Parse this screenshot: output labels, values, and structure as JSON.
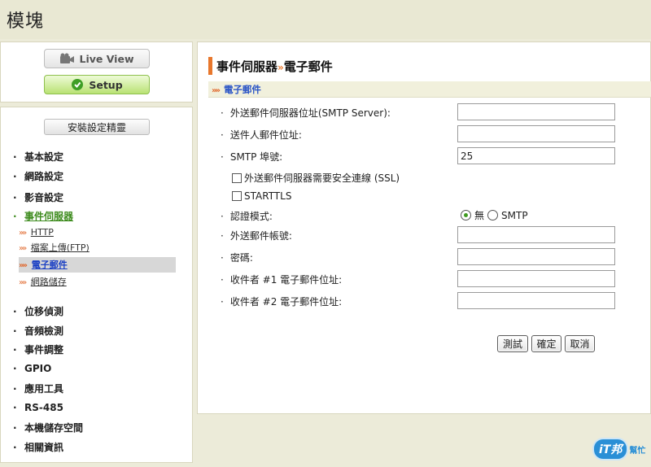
{
  "header": {
    "title": "模塊"
  },
  "modes": {
    "liveview": "Live View",
    "setup": "Setup"
  },
  "wizard": "安裝設定精靈",
  "menu": {
    "basic": "基本設定",
    "network": "網路設定",
    "av": "影音設定",
    "event_server": "事件伺服器",
    "sub": {
      "http": "HTTP",
      "ftp": "檔案上傳(FTP)",
      "email": "電子郵件",
      "netstorage": "網路儲存"
    },
    "motion": "位移偵測",
    "audio_detect": "音頻檢測",
    "event_adjust": "事件調整",
    "gpio": "GPIO",
    "tools": "應用工具",
    "rs485": "RS-485",
    "local_storage": "本機儲存空間",
    "info": "相關資訊"
  },
  "page": {
    "title_main": "事件伺服器",
    "title_sep": "»",
    "title_sub": "電子郵件",
    "section": "電子郵件",
    "section_arrow": "»»"
  },
  "form": {
    "smtp_server_label": "外送郵件伺服器位址(SMTP Server):",
    "smtp_server_value": "",
    "sender_label": "送件人郵件位址:",
    "sender_value": "",
    "port_label": "SMTP 埠號:",
    "port_value": "25",
    "ssl_label": "外送郵件伺服器需要安全連線 (SSL)",
    "starttls_label": "STARTTLS",
    "auth_label": "認證模式:",
    "auth_none": "無",
    "auth_smtp": "SMTP",
    "account_label": "外送郵件帳號:",
    "account_value": "",
    "password_label": "密碼:",
    "password_value": "",
    "recipient1_label": "收件者 #1 電子郵件位址:",
    "recipient1_value": "",
    "recipient2_label": "收件者 #2 電子郵件位址:",
    "recipient2_value": "",
    "bullet": "·"
  },
  "buttons": {
    "test": "測試",
    "confirm": "確定",
    "cancel": "取消"
  },
  "watermark": {
    "badge": "iT邦",
    "text": "幫忙"
  },
  "colors": {
    "accent": "#e8772c",
    "active_green": "#3d8b1d",
    "link_blue": "#2b55c6"
  }
}
